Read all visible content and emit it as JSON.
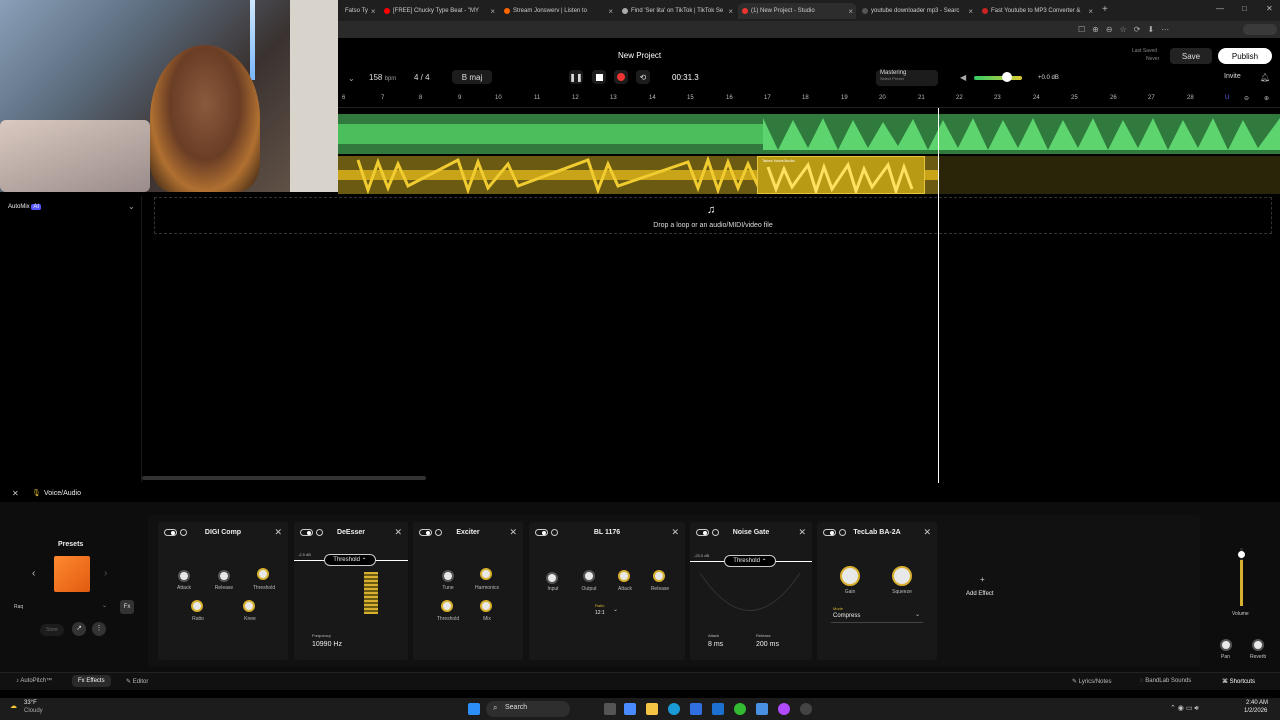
{
  "browser": {
    "tabs": [
      {
        "label": "Fatso Ty",
        "color": "#d33"
      },
      {
        "label": "[FREE] Chucky Type Beat - \"MY",
        "color": "#f00"
      },
      {
        "label": "Stream Jonswerv | Listen to",
        "color": "#f60"
      },
      {
        "label": "Find 'Ser lita' on TikTok | TikTok Se",
        "color": "#222"
      },
      {
        "label": "(1) New Project - Studio",
        "color": "#e33"
      },
      {
        "label": "youtube downloader mp3 - Searc",
        "color": "#555"
      },
      {
        "label": "Fast Youtube to MP3 Converter &",
        "color": "#c22"
      }
    ],
    "new_tab": "+",
    "window_controls": [
      "—",
      "□",
      "✕"
    ]
  },
  "studio": {
    "project_title": "New Project",
    "bpm_value": "158",
    "bpm_unit": "bpm",
    "time_signature": "4 / 4",
    "key": "B maj",
    "time": "00:31.3",
    "mastering_label": "Mastering",
    "mastering_sub": "Select Preset",
    "master_volume": "+0.0 dB",
    "last_saved_label": "Last Saved",
    "last_saved_value": "Never",
    "save_label": "Save",
    "publish_label": "Publish",
    "invite_label": "Invite",
    "ruler_ticks": [
      "6",
      "7",
      "8",
      "9",
      "10",
      "11",
      "12",
      "13",
      "14",
      "15",
      "16",
      "17",
      "18",
      "19",
      "20",
      "21",
      "22",
      "23",
      "24",
      "25",
      "26",
      "27",
      "28"
    ],
    "region_label": "Takes  Voice/Audio",
    "drop_text": "Drop a loop or an audio/MIDI/video file",
    "automix_label": "AutoMix"
  },
  "effects": {
    "track_name": "Voice/Audio",
    "presets_title": "Presets",
    "preset_name": "Raq",
    "store_label": "Store",
    "add_effect_label": "Add Effect",
    "volume_label": "Volume",
    "pan_label": "Pan",
    "reverb_label": "Reverb",
    "cards": {
      "digicomp": {
        "title": "DIGI Comp",
        "knobs": [
          "Attack",
          "Release",
          "Threshold",
          "Ratio",
          "Knee"
        ]
      },
      "deesser": {
        "title": "DeEsser",
        "dropdown": "Threshold",
        "db": "-2.5 dB",
        "freq_label": "Frequency",
        "freq_value": "10990 Hz"
      },
      "exciter": {
        "title": "Exciter",
        "knobs": [
          "Tune",
          "Harmonics",
          "Threshold",
          "Mix"
        ]
      },
      "bl1176": {
        "title": "BL 1176",
        "knobs": [
          "Input",
          "Output",
          "Attack",
          "Release"
        ],
        "ratio_label": "Ratio",
        "ratio_value": "12:1"
      },
      "noisegate": {
        "title": "Noise Gate",
        "dropdown": "Threshold",
        "db": "-23.0 dB",
        "attack_label": "Attack",
        "attack_value": "8 ms",
        "release_label": "Release",
        "release_value": "200 ms"
      },
      "teclab": {
        "title": "TecLab BA-2A",
        "knobs": [
          "Gain",
          "Squeeze"
        ],
        "mode_label": "Mode",
        "mode_value": "Compress"
      }
    }
  },
  "bottom_bar": {
    "autopitch": "AutoPitch™",
    "effects": "Effects",
    "editor": "Editor",
    "lyrics": "Lyrics/Notes",
    "bandlab_sounds": "BandLab Sounds",
    "shortcuts": "Shortcuts"
  },
  "taskbar": {
    "weather_temp": "33°F",
    "weather_desc": "Cloudy",
    "search_label": "Search",
    "clock_time": "2:40 AM",
    "clock_date": "1/2/2026"
  }
}
